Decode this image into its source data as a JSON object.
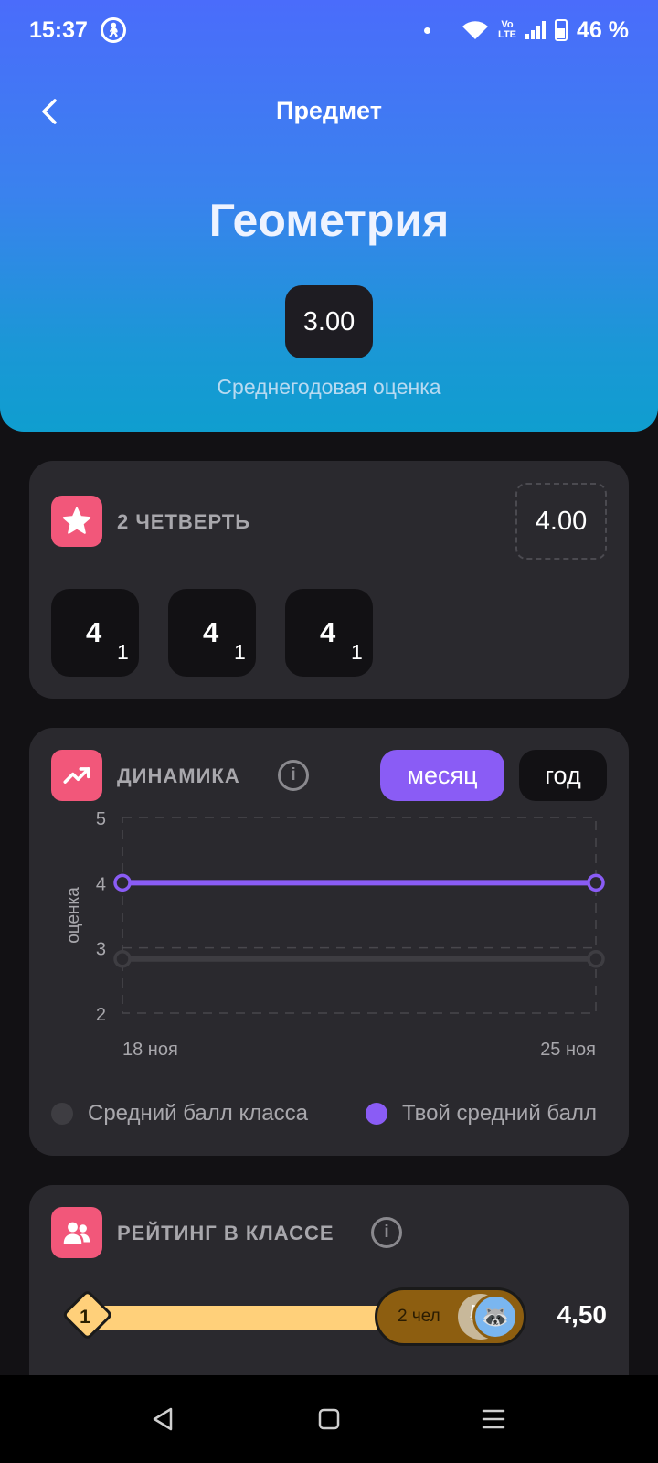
{
  "status_bar": {
    "time": "15:37",
    "battery": "46 %",
    "volte_top": "Vo",
    "volte_bottom": "LTE"
  },
  "header": {
    "title": "Предмет"
  },
  "subject": {
    "name": "Геометрия",
    "annual_average": "3.00",
    "annual_caption": "Среднегодовая оценка"
  },
  "quarter": {
    "title": "2 ЧЕТВЕРТЬ",
    "average": "4.00",
    "grades": [
      {
        "value": "4",
        "weight": "1"
      },
      {
        "value": "4",
        "weight": "1"
      },
      {
        "value": "4",
        "weight": "1"
      }
    ]
  },
  "dynamics": {
    "title": "ДИНАМИКА",
    "tabs": {
      "month": "месяц",
      "year": "год"
    },
    "legend": {
      "class": "Средний балл класса",
      "yours": "Твой средний балл"
    }
  },
  "chart_data": {
    "type": "line",
    "x": [
      "18 ноя",
      "25 ноя"
    ],
    "series": [
      {
        "name": "Средний балл класса",
        "values": [
          2.83,
          2.83
        ]
      },
      {
        "name": "Твой средний балл",
        "values": [
          4.0,
          4.0
        ]
      }
    ],
    "ylabel": "оценка",
    "ylim": [
      2,
      5
    ],
    "yticks": [
      "2",
      "3",
      "4",
      "5"
    ],
    "colors": {
      "class": "#3e3d42",
      "yours": "#8a5cf5"
    },
    "grid": true
  },
  "rating": {
    "title": "РЕЙТИНГ В КЛАССЕ",
    "position": "1",
    "people": "2 чел",
    "score": "4,50",
    "avatars": [
      "cat-avatar-icon",
      "raccoon-avatar-icon"
    ]
  },
  "colors": {
    "accent": "#8a5cf5",
    "icon_bg": "#f2577a",
    "card": "#2a292e",
    "background": "#121114"
  }
}
